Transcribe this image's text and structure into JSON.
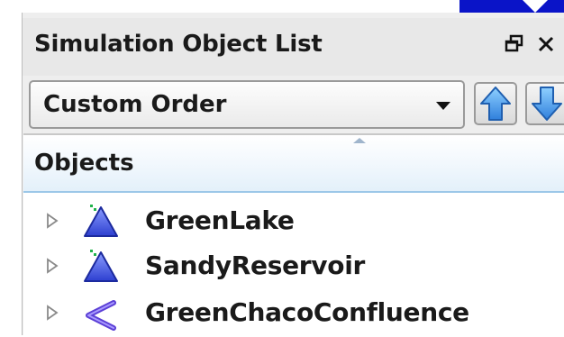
{
  "panel": {
    "title": "Simulation Object List"
  },
  "order_select": {
    "value": "Custom Order"
  },
  "tree": {
    "column_header": "Objects",
    "items": [
      {
        "label": "GreenLake",
        "icon": "reservoir-triangle-icon"
      },
      {
        "label": "SandyReservoir",
        "icon": "reservoir-triangle-icon"
      },
      {
        "label": "GreenChacoConfluence",
        "icon": "confluence-icon"
      }
    ]
  },
  "icons": {
    "restore": "restore-window-icon",
    "close": "close-icon",
    "move_up": "arrow-up-icon",
    "move_down": "arrow-down-icon",
    "expander": "expand-triangle-icon"
  },
  "colors": {
    "header_bg": "#e3f0fa",
    "reservoir_icon": "#3b4fd8",
    "confluence_icon": "#5b3fd6",
    "arrow_buttons": "#3a8fe0"
  }
}
